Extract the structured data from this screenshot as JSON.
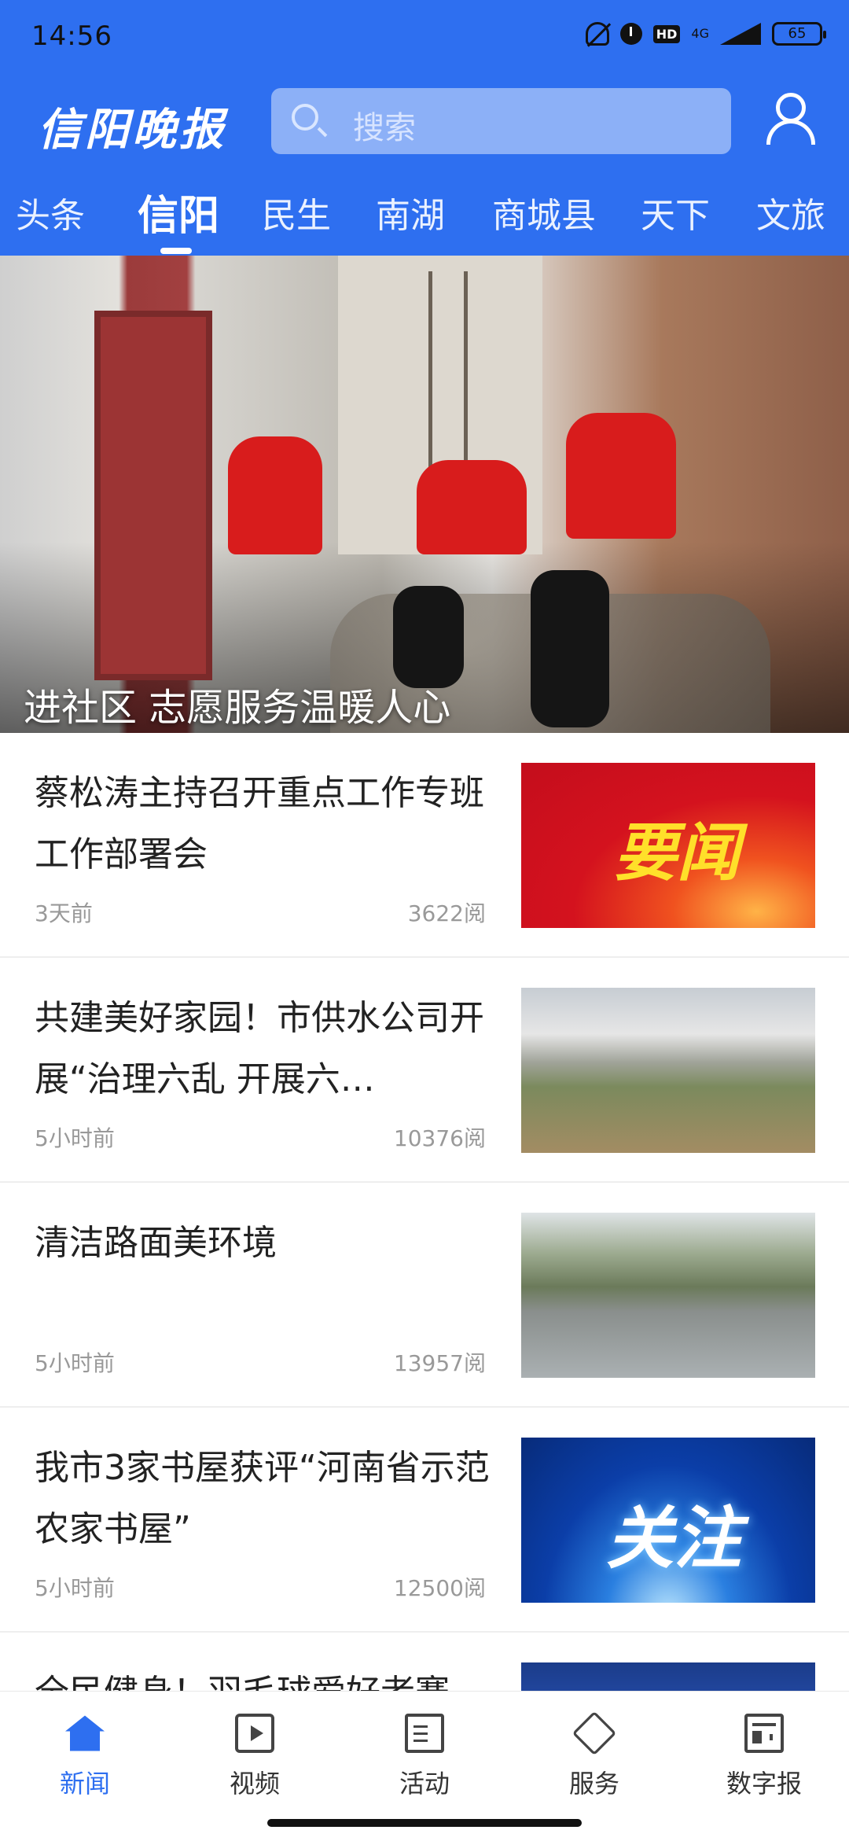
{
  "status_bar": {
    "time": "14:56",
    "network": "4G",
    "battery": "65",
    "icons": [
      "mute-bell-icon",
      "alarm-clock-icon",
      "hd-icon",
      "signal-icon",
      "battery-icon"
    ]
  },
  "header": {
    "logo_text": "信阳晚报",
    "search_placeholder": "搜索",
    "accent_color": "#2e6ff0"
  },
  "tabs": [
    {
      "label": "头条",
      "active": false
    },
    {
      "label": "信阳",
      "active": true
    },
    {
      "label": "民生",
      "active": false
    },
    {
      "label": "南湖",
      "active": false
    },
    {
      "label": "商城县",
      "active": false
    },
    {
      "label": "天下",
      "active": false
    },
    {
      "label": "文旅",
      "active": false
    }
  ],
  "banner": {
    "title": "进社区 志愿服务温暖人心",
    "slide_count": 5,
    "current_slide": 2
  },
  "news": [
    {
      "title": "蔡松涛主持召开重点工作专班工作部署会",
      "time": "3天前",
      "reads": "3622阅",
      "thumb_text": "要闻"
    },
    {
      "title": "共建美好家园！市供水公司开展“治理六乱 开展六…",
      "time": "5小时前",
      "reads": "10376阅",
      "thumb_text": ""
    },
    {
      "title": "清洁路面美环境",
      "time": "5小时前",
      "reads": "13957阅",
      "thumb_text": ""
    },
    {
      "title": "我市3家书屋获评“河南省示范农家书屋”",
      "time": "5小时前",
      "reads": "12500阅",
      "thumb_text": "关注"
    },
    {
      "title": "全民健身！羽毛球爱好者赛",
      "time": "",
      "reads": "",
      "thumb_text": ""
    }
  ],
  "bottom_nav": [
    {
      "label": "新闻",
      "icon": "home-icon",
      "active": true
    },
    {
      "label": "视频",
      "icon": "video-icon",
      "active": false
    },
    {
      "label": "活动",
      "icon": "activity-icon",
      "active": false
    },
    {
      "label": "服务",
      "icon": "service-icon",
      "active": false
    },
    {
      "label": "数字报",
      "icon": "newspaper-icon",
      "active": false
    }
  ]
}
